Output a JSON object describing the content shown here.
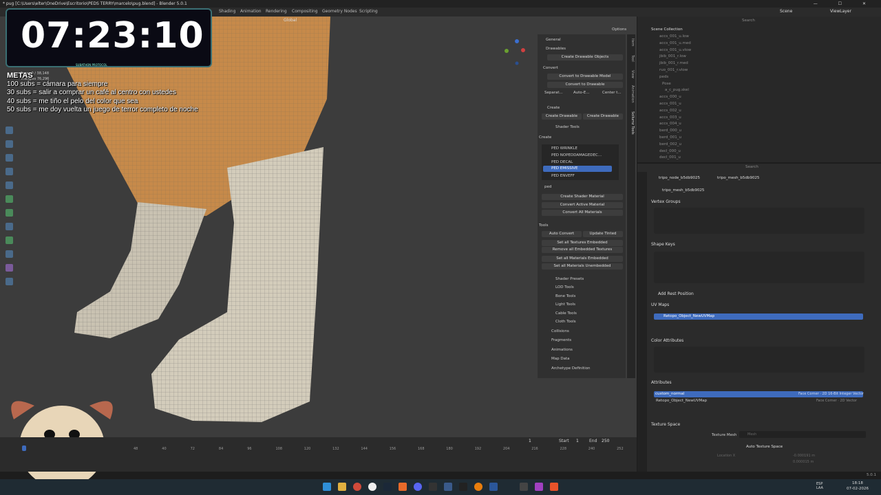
{
  "titlebar": {
    "title": "* pug [C:\\Users\\elter\\OneDrive\\Escritorio\\PEDS TERRY\\marcelo\\pug.blend] - Blender 5.0.1",
    "controls": "—  ☐  ✕"
  },
  "workspaces": [
    "Shading",
    "Animation",
    "Rendering",
    "Compositing",
    "Geometry Nodes",
    "Scripting"
  ],
  "topbar_right": {
    "scene": "Scene",
    "view_layer": "ViewLayer"
  },
  "viewport_header": {
    "orientation": "Global",
    "options": "Options"
  },
  "timer": "07:23:10",
  "timer_caption": "SUBATHON PROTOCOL",
  "stats": [
    "Faces  0 / 38,148",
    "Triangles  76,296"
  ],
  "goals": {
    "title": "METAS",
    "items": [
      "100 subs = cámara para siempre",
      "30 subs = salir a comprar un café al centro con ustedes",
      "40 subs = me tiño el pelo del color que sea",
      "50 subs = me doy vuelta un juego de terror completo de noche"
    ]
  },
  "npanel": {
    "general": "General",
    "drawables": "Drawables",
    "create_drawable_objects": "Create Drawable Objects",
    "convert": "Convert",
    "convert_to_drawable_model": "Convert to Drawable Model",
    "convert_to_drawable": "Convert to Drawable",
    "separate": "Separat...",
    "auto_e": "Auto-E...",
    "center": "Center t...",
    "create": "Create",
    "create_drawable": "Create Drawable",
    "create_drawable2": "Create Drawable",
    "shader_tools": "Shader Tools",
    "create_label": "Create",
    "shaders": [
      "PED WRINKLE",
      "PED NOPEDDAMAGEDEC...",
      "PED DECAL",
      "PED EMISSIVE",
      "PED ENVEFF"
    ],
    "filter": "ped",
    "create_shader_material": "Create Shader Material",
    "convert_active_material": "Convert Active Material",
    "convert_all_materials": "Convert All Materials",
    "tools": "Tools",
    "auto_convert": "Auto Convert",
    "update_tinted": "Update Tinted",
    "set_all_textures_embedded": "Set all Textures Embedded",
    "remove_all_embedded_textures": "Remove all Embedded Textures",
    "set_all_materials_embedded": "Set all Materials Embedded",
    "set_all_materials_unembedded": "Set all Materials Unembedded",
    "subsections": [
      "Shader Presets",
      "LOD Tools",
      "Bone Tools",
      "Light Tools",
      "Cable Tools",
      "Cloth Tools"
    ],
    "sections": [
      "Collisions",
      "Fragments",
      "Animations",
      "Map Data",
      "Archetype Definition"
    ]
  },
  "npanel_tabs": [
    "Item",
    "Tool",
    "View",
    "Animation",
    "Sollumz Tools"
  ],
  "outliner": {
    "search": "Search",
    "root": "Scene Collection",
    "rows": [
      "accs_001_u.low",
      "accs_001_u.med",
      "accs_001_u.vlow",
      "jbib_001_r.low",
      "jbib_001_r.med",
      "ruo_001_r.vlow",
      "peds",
      "Pose",
      "a_c_pug.skel",
      "accs_000_u",
      "accs_001_u",
      "accs_002_u",
      "accs_003_u",
      "accs_004_u",
      "berd_000_u",
      "berd_001_u",
      "berd_002_u",
      "decl_000_u",
      "decl_001_u"
    ]
  },
  "properties": {
    "search": "Search",
    "breadcrumb": [
      "tripo_node_b5db9025",
      "tripo_mesh_b5db9025"
    ],
    "mesh_name": "tripo_mesh_b5db9025",
    "vertex_groups": "Vertex Groups",
    "shape_keys": "Shape Keys",
    "add_rest_position": "Add Rest Position",
    "uv_maps": "UV Maps",
    "uv_map_selected": "Retopo_Object_NewUVMap",
    "color_attributes": "Color Attributes",
    "attributes": "Attributes",
    "attr_rows": [
      {
        "name": "custom_normal",
        "type": "Face Corner · 2D 16-Bit Integer Vector"
      },
      {
        "name": "Retopo_Object_NewUVMap",
        "type": "Face Corner · 2D Vector"
      }
    ],
    "texture_space": "Texture Space",
    "texture_mesh_label": "Texture Mesh",
    "texture_mesh_placeholder": "Mesh",
    "auto_texture_space": "Auto Texture Space",
    "location_label": "Location X",
    "loc_x": "-0.000191 m",
    "loc_y": "0.000015 m"
  },
  "timeline": {
    "frame": "1",
    "start_label": "Start",
    "start": "1",
    "end_label": "End",
    "end": "250",
    "ticks": [
      "48",
      "40",
      "72",
      "84",
      "96",
      "108",
      "120",
      "132",
      "144",
      "156",
      "168",
      "180",
      "192",
      "204",
      "216",
      "228",
      "240",
      "252"
    ]
  },
  "version": "5.0.1",
  "taskbar": {
    "lang": "ESP\nLAA",
    "time": "18:18",
    "date": "07-02-2026"
  },
  "colors": {
    "accent": "#3e6bbd",
    "sweater": "#c68a4a",
    "sock": "#d3ccbb",
    "timer_border": "#3a6f73"
  }
}
